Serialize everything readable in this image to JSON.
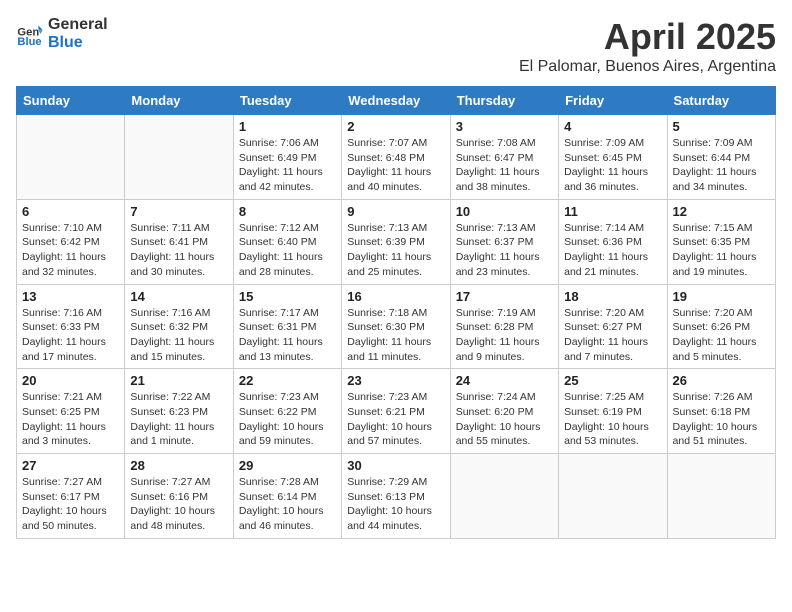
{
  "header": {
    "logo_general": "General",
    "logo_blue": "Blue",
    "title": "April 2025",
    "subtitle": "El Palomar, Buenos Aires, Argentina"
  },
  "days_of_week": [
    "Sunday",
    "Monday",
    "Tuesday",
    "Wednesday",
    "Thursday",
    "Friday",
    "Saturday"
  ],
  "weeks": [
    [
      {
        "day": "",
        "info": ""
      },
      {
        "day": "",
        "info": ""
      },
      {
        "day": "1",
        "info": "Sunrise: 7:06 AM\nSunset: 6:49 PM\nDaylight: 11 hours and 42 minutes."
      },
      {
        "day": "2",
        "info": "Sunrise: 7:07 AM\nSunset: 6:48 PM\nDaylight: 11 hours and 40 minutes."
      },
      {
        "day": "3",
        "info": "Sunrise: 7:08 AM\nSunset: 6:47 PM\nDaylight: 11 hours and 38 minutes."
      },
      {
        "day": "4",
        "info": "Sunrise: 7:09 AM\nSunset: 6:45 PM\nDaylight: 11 hours and 36 minutes."
      },
      {
        "day": "5",
        "info": "Sunrise: 7:09 AM\nSunset: 6:44 PM\nDaylight: 11 hours and 34 minutes."
      }
    ],
    [
      {
        "day": "6",
        "info": "Sunrise: 7:10 AM\nSunset: 6:42 PM\nDaylight: 11 hours and 32 minutes."
      },
      {
        "day": "7",
        "info": "Sunrise: 7:11 AM\nSunset: 6:41 PM\nDaylight: 11 hours and 30 minutes."
      },
      {
        "day": "8",
        "info": "Sunrise: 7:12 AM\nSunset: 6:40 PM\nDaylight: 11 hours and 28 minutes."
      },
      {
        "day": "9",
        "info": "Sunrise: 7:13 AM\nSunset: 6:39 PM\nDaylight: 11 hours and 25 minutes."
      },
      {
        "day": "10",
        "info": "Sunrise: 7:13 AM\nSunset: 6:37 PM\nDaylight: 11 hours and 23 minutes."
      },
      {
        "day": "11",
        "info": "Sunrise: 7:14 AM\nSunset: 6:36 PM\nDaylight: 11 hours and 21 minutes."
      },
      {
        "day": "12",
        "info": "Sunrise: 7:15 AM\nSunset: 6:35 PM\nDaylight: 11 hours and 19 minutes."
      }
    ],
    [
      {
        "day": "13",
        "info": "Sunrise: 7:16 AM\nSunset: 6:33 PM\nDaylight: 11 hours and 17 minutes."
      },
      {
        "day": "14",
        "info": "Sunrise: 7:16 AM\nSunset: 6:32 PM\nDaylight: 11 hours and 15 minutes."
      },
      {
        "day": "15",
        "info": "Sunrise: 7:17 AM\nSunset: 6:31 PM\nDaylight: 11 hours and 13 minutes."
      },
      {
        "day": "16",
        "info": "Sunrise: 7:18 AM\nSunset: 6:30 PM\nDaylight: 11 hours and 11 minutes."
      },
      {
        "day": "17",
        "info": "Sunrise: 7:19 AM\nSunset: 6:28 PM\nDaylight: 11 hours and 9 minutes."
      },
      {
        "day": "18",
        "info": "Sunrise: 7:20 AM\nSunset: 6:27 PM\nDaylight: 11 hours and 7 minutes."
      },
      {
        "day": "19",
        "info": "Sunrise: 7:20 AM\nSunset: 6:26 PM\nDaylight: 11 hours and 5 minutes."
      }
    ],
    [
      {
        "day": "20",
        "info": "Sunrise: 7:21 AM\nSunset: 6:25 PM\nDaylight: 11 hours and 3 minutes."
      },
      {
        "day": "21",
        "info": "Sunrise: 7:22 AM\nSunset: 6:23 PM\nDaylight: 11 hours and 1 minute."
      },
      {
        "day": "22",
        "info": "Sunrise: 7:23 AM\nSunset: 6:22 PM\nDaylight: 10 hours and 59 minutes."
      },
      {
        "day": "23",
        "info": "Sunrise: 7:23 AM\nSunset: 6:21 PM\nDaylight: 10 hours and 57 minutes."
      },
      {
        "day": "24",
        "info": "Sunrise: 7:24 AM\nSunset: 6:20 PM\nDaylight: 10 hours and 55 minutes."
      },
      {
        "day": "25",
        "info": "Sunrise: 7:25 AM\nSunset: 6:19 PM\nDaylight: 10 hours and 53 minutes."
      },
      {
        "day": "26",
        "info": "Sunrise: 7:26 AM\nSunset: 6:18 PM\nDaylight: 10 hours and 51 minutes."
      }
    ],
    [
      {
        "day": "27",
        "info": "Sunrise: 7:27 AM\nSunset: 6:17 PM\nDaylight: 10 hours and 50 minutes."
      },
      {
        "day": "28",
        "info": "Sunrise: 7:27 AM\nSunset: 6:16 PM\nDaylight: 10 hours and 48 minutes."
      },
      {
        "day": "29",
        "info": "Sunrise: 7:28 AM\nSunset: 6:14 PM\nDaylight: 10 hours and 46 minutes."
      },
      {
        "day": "30",
        "info": "Sunrise: 7:29 AM\nSunset: 6:13 PM\nDaylight: 10 hours and 44 minutes."
      },
      {
        "day": "",
        "info": ""
      },
      {
        "day": "",
        "info": ""
      },
      {
        "day": "",
        "info": ""
      }
    ]
  ]
}
